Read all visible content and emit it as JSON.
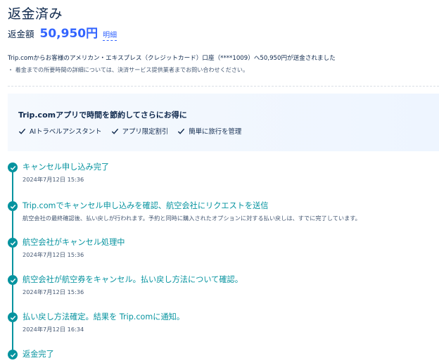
{
  "header": {
    "title": "返金済み"
  },
  "amount": {
    "label": "返金額",
    "value": "50,950円",
    "link": "明細"
  },
  "notice": {
    "main": "Trip.comからお客様のアメリカン・エキスプレス（クレジットカード）口座（****1009）へ50,950円が送金されました",
    "sub": "・ 着金までの所要時間の詳細については、決済サービス提供業者までお問い合わせください。"
  },
  "promo": {
    "title": "Trip.comアプリで時間を節約してさらにお得に",
    "features": [
      "AIトラベルアシスタント",
      "アプリ限定割引",
      "簡単に旅行を管理"
    ]
  },
  "timeline": [
    {
      "title": "キャンセル申し込み完了",
      "sub": "2024年7月12日 15:36"
    },
    {
      "title": "Trip.comでキャンセル申し込みを確認、航空会社にリクエストを送信",
      "sub": "航空会社の最終確認後、払い戻しが行われます。予約と同時に購入されたオプションに対する払い戻しは、すでに完了しています。"
    },
    {
      "title": "航空会社がキャンセル処理中",
      "sub": "2024年7月12日 15:36"
    },
    {
      "title": "航空会社が航空券をキャンセル。払い戻し方法について確認。",
      "sub": "2024年7月12日 15:36"
    },
    {
      "title": "払い戻し方法確定。結果を Trip.comに通知。",
      "sub": "2024年7月12日 16:34"
    },
    {
      "title": "返金完了",
      "sub": ""
    }
  ],
  "colors": {
    "accent": "#05939f",
    "link": "#3264ff",
    "text": "#0f294d"
  }
}
